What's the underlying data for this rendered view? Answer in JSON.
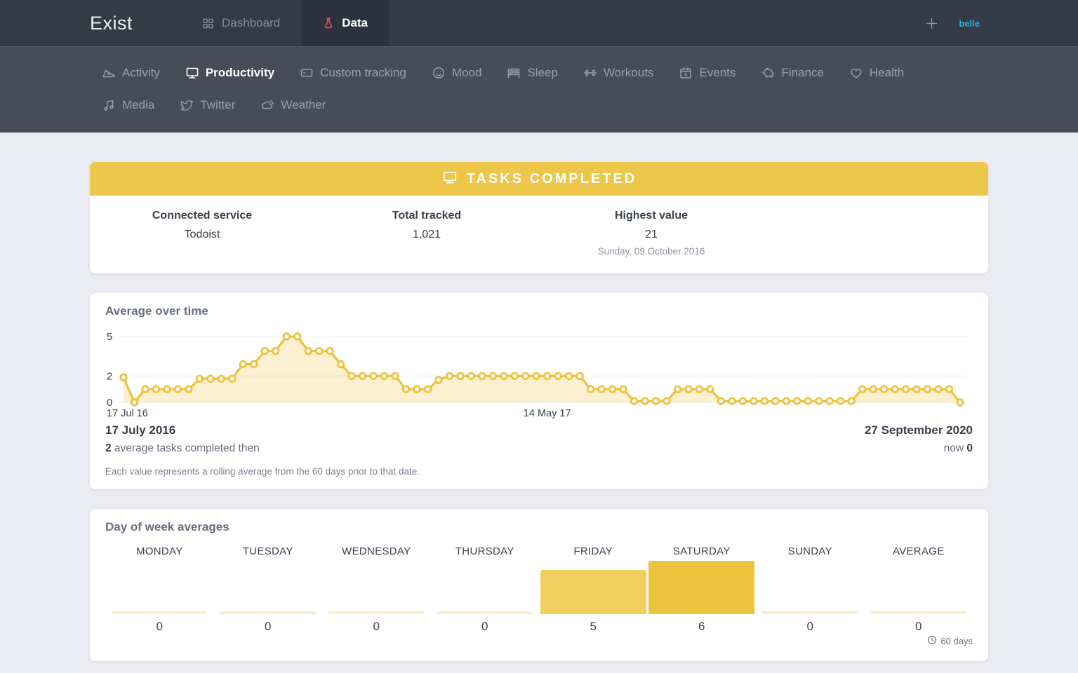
{
  "topnav": {
    "brand": "Exist",
    "dashboard_label": "Dashboard",
    "data_label": "Data",
    "user": "belle"
  },
  "subnav": {
    "items": [
      {
        "label": "Activity"
      },
      {
        "label": "Productivity"
      },
      {
        "label": "Custom tracking"
      },
      {
        "label": "Mood"
      },
      {
        "label": "Sleep"
      },
      {
        "label": "Workouts"
      },
      {
        "label": "Events"
      },
      {
        "label": "Finance"
      },
      {
        "label": "Health"
      },
      {
        "label": "Media"
      },
      {
        "label": "Twitter"
      },
      {
        "label": "Weather"
      }
    ],
    "active": "Productivity"
  },
  "summary": {
    "banner": "TASKS COMPLETED",
    "banner_color": "#edc74a",
    "stats": [
      {
        "label": "Connected service",
        "value": "Todoist"
      },
      {
        "label": "Total tracked",
        "value": "1,021"
      },
      {
        "label": "Highest value",
        "value": "21",
        "date": "Sunday, 09 October 2016"
      }
    ]
  },
  "average": {
    "start_date": "17 July 2016",
    "start_value": "2",
    "start_text": " average tasks completed then",
    "end_date": "27 September 2020",
    "end_label": "now ",
    "end_value": "0",
    "footnote": "Each value represents a rolling average from the 60 days prior to that date."
  },
  "chart_data": [
    {
      "type": "area",
      "title": "Average over time",
      "ylabel": "",
      "xlabel": "",
      "y_ticks": [
        0,
        2,
        5
      ],
      "ylim": [
        0,
        5.2
      ],
      "x_range": [
        "17 July 2016",
        "27 September 2020"
      ],
      "x_tick_labels": [
        {
          "label": "17 Jul 16",
          "index": 0
        },
        {
          "label": "14 May 17",
          "index": 39
        }
      ],
      "line_color": "#efc23e",
      "fill_color": "rgba(240,196,64,0.25)",
      "values": [
        1.9,
        0,
        1,
        1,
        1,
        1,
        1,
        1.8,
        1.8,
        1.8,
        1.8,
        2.9,
        2.9,
        3.9,
        3.9,
        5,
        5,
        3.9,
        3.9,
        3.9,
        2.9,
        2,
        2,
        2,
        2,
        2,
        1,
        1,
        1,
        1.7,
        2,
        2,
        2,
        2,
        2,
        2,
        2,
        2,
        2,
        2,
        2,
        2,
        2,
        1,
        1,
        1,
        1,
        0.1,
        0.1,
        0.1,
        0.1,
        1,
        1,
        1,
        1,
        0.1,
        0.1,
        0.1,
        0.1,
        0.1,
        0.1,
        0.1,
        0.1,
        0.1,
        0.1,
        0.1,
        0.1,
        0.1,
        1,
        1,
        1,
        1,
        1,
        1,
        1,
        1,
        1,
        0
      ]
    },
    {
      "type": "bar",
      "title": "Day of week averages",
      "categories": [
        "MONDAY",
        "TUESDAY",
        "WEDNESDAY",
        "THURSDAY",
        "FRIDAY",
        "SATURDAY",
        "SUNDAY",
        "AVERAGE"
      ],
      "values": [
        0,
        0,
        0,
        0,
        5,
        6,
        0,
        0
      ],
      "ylim": [
        0,
        6
      ],
      "bar_colors": [
        null,
        null,
        null,
        null,
        "#f2cf5e",
        "#ecc33d",
        null,
        null
      ],
      "baseline_color": "#fbeecb",
      "period_label": "60 days"
    }
  ]
}
